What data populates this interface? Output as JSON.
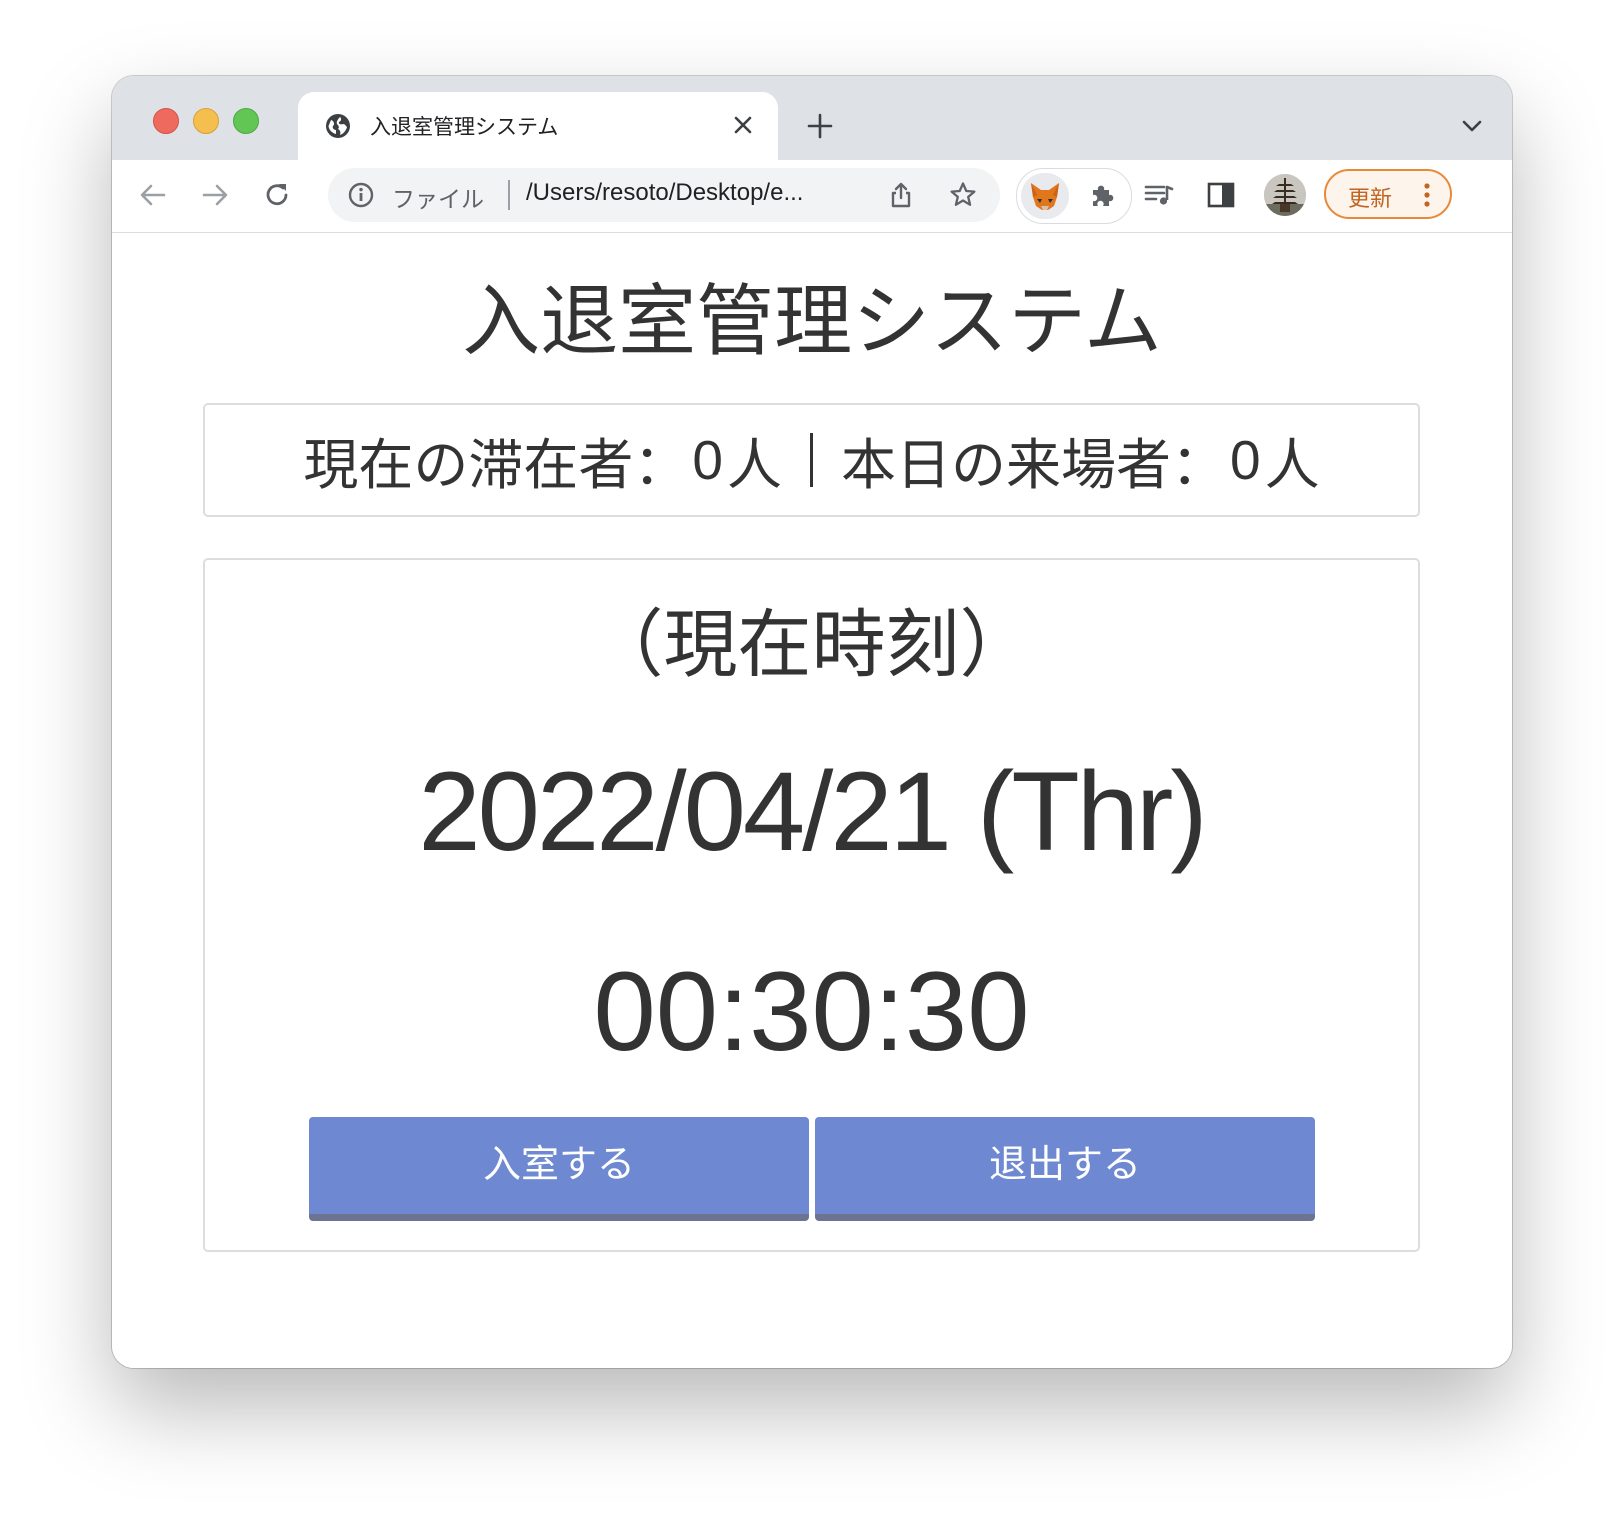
{
  "browser": {
    "tab_title": "入退室管理システム",
    "omnibox": {
      "file_label": "ファイル",
      "url": "/Users/resoto/Desktop/e..."
    },
    "update_label": "更新",
    "icons": [
      "back-icon",
      "forward-icon",
      "reload-icon",
      "info-icon",
      "share-icon",
      "star-icon",
      "metamask-fox-icon",
      "puzzle-icon",
      "media-icon",
      "side-panel-icon",
      "avatar",
      "more-icon",
      "globe-icon",
      "close-icon",
      "plus-icon",
      "chevron-down-icon"
    ],
    "colors": {
      "tabstrip": "#dee1e6",
      "update_border": "#e8893a",
      "update_text": "#c26522"
    }
  },
  "page": {
    "title": "入退室管理システム",
    "stats": {
      "current_label": "現在の滞在者：",
      "current_count": "0",
      "current_unit": "人",
      "today_label": "本日の来場者：",
      "today_count": "0",
      "today_unit": "人"
    },
    "clock": {
      "label": "（現在時刻）",
      "date": "2022/04/21 (Thr)",
      "time": "00:30:30"
    },
    "buttons": {
      "enter": "入室する",
      "exit": "退出する"
    },
    "colors": {
      "button_bg": "#6e89d2",
      "button_border": "#6b7592",
      "text": "#333333"
    }
  }
}
